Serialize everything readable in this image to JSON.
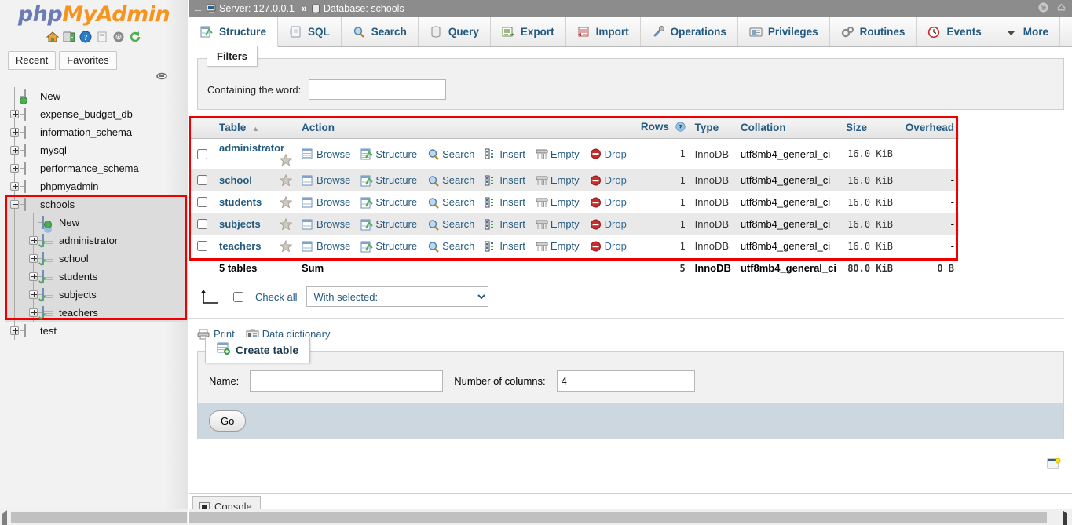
{
  "brand": {
    "php": "php",
    "my": "My",
    "admin": "Admin"
  },
  "logo_icons": [
    {
      "name": "home-icon"
    },
    {
      "name": "server-exit-icon"
    },
    {
      "name": "help-icon"
    },
    {
      "name": "docs-icon"
    },
    {
      "name": "settings-gear-icon"
    },
    {
      "name": "reload-icon"
    }
  ],
  "sidebar": {
    "recent_label": "Recent",
    "favorites_label": "Favorites",
    "pin_icon": "pin-icon",
    "tree": [
      {
        "label": "New",
        "icon": "new-db-icon",
        "toggle": "none",
        "level": 0,
        "selected": false
      },
      {
        "label": "expense_budget_db",
        "icon": "db-icon",
        "toggle": "plus",
        "level": 0,
        "selected": false
      },
      {
        "label": "information_schema",
        "icon": "db-icon",
        "toggle": "plus",
        "level": 0,
        "selected": false
      },
      {
        "label": "mysql",
        "icon": "db-icon",
        "toggle": "plus",
        "level": 0,
        "selected": false
      },
      {
        "label": "performance_schema",
        "icon": "db-icon",
        "toggle": "plus",
        "level": 0,
        "selected": false
      },
      {
        "label": "phpmyadmin",
        "icon": "db-icon",
        "toggle": "plus",
        "level": 0,
        "selected": false
      },
      {
        "label": "schools",
        "icon": "db-icon",
        "toggle": "minus",
        "level": 0,
        "selected": true
      },
      {
        "label": "New",
        "icon": "new-table-icon",
        "toggle": "none",
        "level": 1,
        "selected": true
      },
      {
        "label": "administrator",
        "icon": "table-icon",
        "toggle": "plus",
        "level": 1,
        "selected": true
      },
      {
        "label": "school",
        "icon": "table-icon",
        "toggle": "plus",
        "level": 1,
        "selected": true
      },
      {
        "label": "students",
        "icon": "table-icon",
        "toggle": "plus",
        "level": 1,
        "selected": true
      },
      {
        "label": "subjects",
        "icon": "table-icon",
        "toggle": "plus",
        "level": 1,
        "selected": true
      },
      {
        "label": "teachers",
        "icon": "table-icon",
        "toggle": "plus",
        "level": 1,
        "selected": true
      },
      {
        "label": "test",
        "icon": "db-icon",
        "toggle": "plus",
        "level": 0,
        "selected": false
      }
    ]
  },
  "breadcrumb": {
    "back_arrow": "←",
    "server_label": "Server: 127.0.0.1",
    "separator": "»",
    "database_label": "Database: schools"
  },
  "topright_icons": [
    {
      "name": "settings-gear-icon"
    },
    {
      "name": "collapse-icon"
    }
  ],
  "tabs": [
    {
      "label": "Structure",
      "icon": "structure-icon",
      "active": true
    },
    {
      "label": "SQL",
      "icon": "sql-icon",
      "active": false
    },
    {
      "label": "Search",
      "icon": "search-icon",
      "active": false
    },
    {
      "label": "Query",
      "icon": "query-icon",
      "active": false
    },
    {
      "label": "Export",
      "icon": "export-icon",
      "active": false
    },
    {
      "label": "Import",
      "icon": "import-icon",
      "active": false
    },
    {
      "label": "Operations",
      "icon": "operations-wrench-icon",
      "active": false
    },
    {
      "label": "Privileges",
      "icon": "privileges-icon",
      "active": false
    },
    {
      "label": "Routines",
      "icon": "routines-gears-icon",
      "active": false
    },
    {
      "label": "Events",
      "icon": "events-clock-icon",
      "active": false
    },
    {
      "label": "More",
      "icon": "chevron-down-icon",
      "active": false
    }
  ],
  "filters": {
    "legend": "Filters",
    "containing_label": "Containing the word:",
    "containing_value": "",
    "containing_placeholder": ""
  },
  "table": {
    "headers": [
      "Table",
      "Action",
      "Rows",
      "Type",
      "Collation",
      "Size",
      "Overhead"
    ],
    "sort_indicator": "▲",
    "rows_help_icon": "help-icon",
    "actions": [
      {
        "label": "Browse",
        "icon": "browse-icon"
      },
      {
        "label": "Structure",
        "icon": "structure-icon"
      },
      {
        "label": "Search",
        "icon": "search-icon"
      },
      {
        "label": "Insert",
        "icon": "insert-icon"
      },
      {
        "label": "Empty",
        "icon": "empty-icon"
      },
      {
        "label": "Drop",
        "icon": "drop-icon"
      }
    ],
    "rows": [
      {
        "name": "administrator",
        "rows": "1",
        "type": "InnoDB",
        "collation": "utf8mb4_general_ci",
        "size": "16.0 KiB",
        "overhead": "-"
      },
      {
        "name": "school",
        "rows": "1",
        "type": "InnoDB",
        "collation": "utf8mb4_general_ci",
        "size": "16.0 KiB",
        "overhead": "-"
      },
      {
        "name": "students",
        "rows": "1",
        "type": "InnoDB",
        "collation": "utf8mb4_general_ci",
        "size": "16.0 KiB",
        "overhead": "-"
      },
      {
        "name": "subjects",
        "rows": "1",
        "type": "InnoDB",
        "collation": "utf8mb4_general_ci",
        "size": "16.0 KiB",
        "overhead": "-"
      },
      {
        "name": "teachers",
        "rows": "1",
        "type": "InnoDB",
        "collation": "utf8mb4_general_ci",
        "size": "16.0 KiB",
        "overhead": "-"
      }
    ],
    "summary": {
      "count_label": "5 tables",
      "sum_label": "Sum",
      "rows": "5",
      "type": "InnoDB",
      "collation": "utf8mb4_general_ci",
      "size": "80.0 KiB",
      "overhead": "0 B"
    }
  },
  "bulk": {
    "check_all_label": "Check all",
    "with_selected_label": "With selected:",
    "with_selected_options": [
      "With selected:"
    ]
  },
  "footer_links": [
    {
      "label": "Print",
      "icon": "printer-icon"
    },
    {
      "label": "Data dictionary",
      "icon": "data-dictionary-icon"
    }
  ],
  "create_table": {
    "legend": "Create table",
    "legend_icon": "new-table-icon",
    "name_label": "Name:",
    "name_value": "",
    "columns_label": "Number of columns:",
    "columns_value": "4",
    "go_label": "Go"
  },
  "console": {
    "label": "Console",
    "icon": "console-icon"
  },
  "window_icon": "restore-window-icon",
  "colors": {
    "highlight_red": "#ee0000",
    "link_blue": "#235a81",
    "brand_orange": "#f7941e",
    "brand_purple": "#6c7ab5",
    "topbar_gray": "#8c8c8c"
  }
}
